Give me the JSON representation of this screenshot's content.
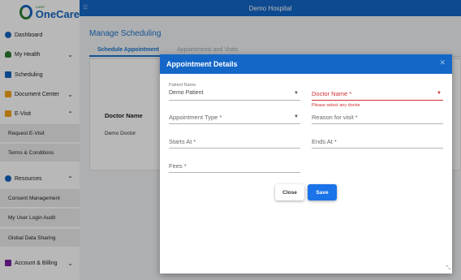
{
  "logo": {
    "small": "CARE",
    "main": "OneCare"
  },
  "header": {
    "title": "Demo Hospital"
  },
  "sidebar": {
    "items": [
      {
        "label": "Dashboard"
      },
      {
        "label": "My Health"
      },
      {
        "label": "Scheduling"
      },
      {
        "label": "Document Center"
      },
      {
        "label": "E-Visit"
      },
      {
        "label": "Resources"
      },
      {
        "label": "Account & Billing"
      }
    ],
    "evisit_sub": [
      "Request E-Visit",
      "Terms & Conditions"
    ],
    "resources_sub": [
      "Consent Management",
      "My User Login Audit",
      "Global Data Sharing"
    ]
  },
  "main": {
    "title": "Manage Scheduling",
    "tabs": [
      "Schedule Appointment",
      "Appointments and Visits"
    ],
    "table": {
      "column": "Doctor Name",
      "cell": "Demo Doctor"
    }
  },
  "modal": {
    "title": "Appointment Details",
    "patient_name_label": "Patient Name",
    "patient_name_value": "Demo Patient",
    "doctor_name": "Doctor Name *",
    "doctor_error": "Please select any doctor",
    "appointment_type": "Appointment Type *",
    "reason": "Reason for visit *",
    "starts_at": "Starts At *",
    "ends_at": "Ends At *",
    "fees": "Fees *",
    "close_label": "Close",
    "save_label": "Save"
  },
  "colors": {
    "brand": "#1467c7",
    "error": "#d32f2f",
    "save": "#1a73e8"
  }
}
